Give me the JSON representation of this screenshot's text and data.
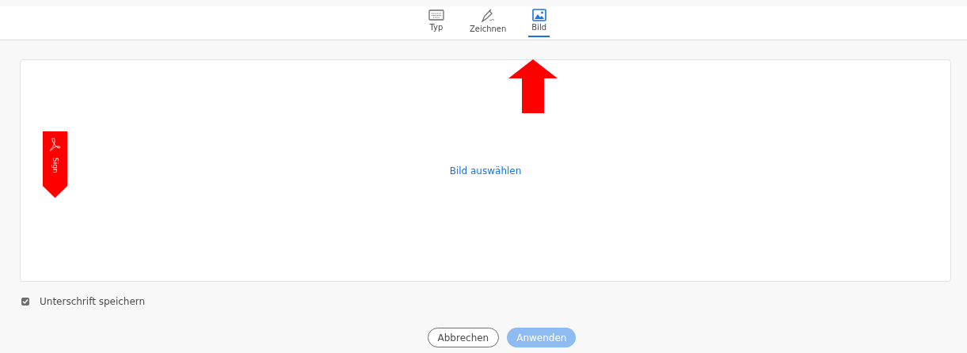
{
  "tabs": [
    {
      "label": "Typ",
      "selected": false
    },
    {
      "label": "Zeichnen",
      "selected": false
    },
    {
      "label": "Bild",
      "selected": true
    }
  ],
  "panel": {
    "link": "Bild auswählen"
  },
  "badge": {
    "text": "Sign"
  },
  "save_signature": {
    "label": "Unterschrift speichern",
    "checked": true
  },
  "buttons": [
    {
      "label": "Abbrechen",
      "kind": "secondary",
      "disabled": false
    },
    {
      "label": "Anwenden",
      "kind": "primary",
      "disabled": true
    }
  ]
}
